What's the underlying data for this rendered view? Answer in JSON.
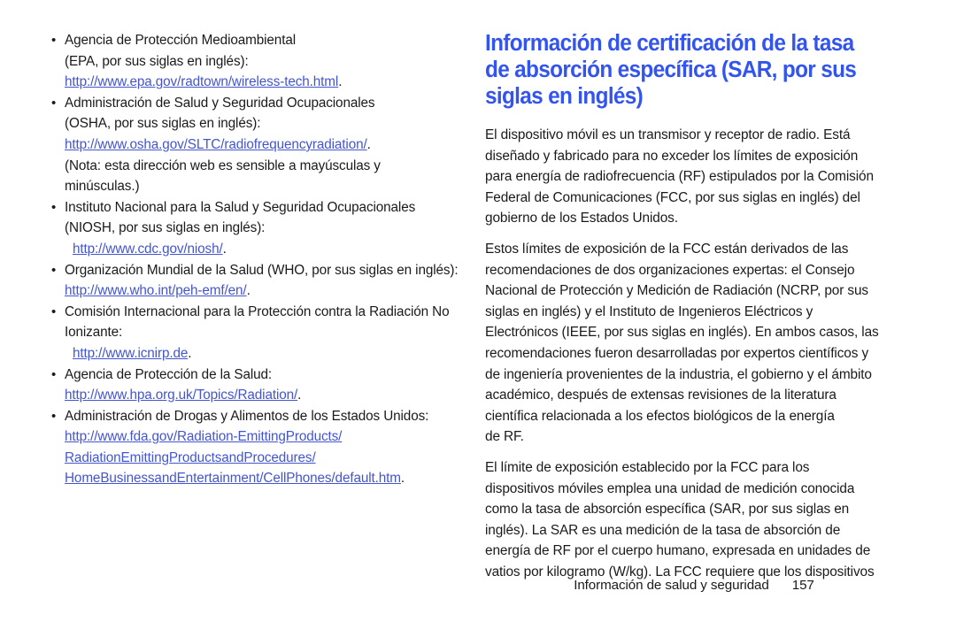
{
  "left_column": {
    "entries": [
      {
        "bullet": "•",
        "lines": [
          {
            "text": "Agencia de Protección Medioambiental",
            "type": "text",
            "indent": false
          },
          {
            "text": "(EPA, por sus siglas en inglés):",
            "type": "text",
            "indent": false
          },
          {
            "text": "http://www.epa.gov/radtown/wireless-tech.html",
            "type": "url",
            "trailing": ".",
            "indent": false
          }
        ]
      },
      {
        "bullet": "•",
        "lines": [
          {
            "text": "Administración de Salud y Seguridad Ocupacionales",
            "type": "text",
            "indent": false
          },
          {
            "text": "(OSHA, por sus siglas en inglés):",
            "type": "text",
            "indent": false
          },
          {
            "text": "http://www.osha.gov/SLTC/radiofrequencyradiation/",
            "type": "url",
            "trailing": ".",
            "indent": false
          },
          {
            "text": "(Nota: esta dirección web es sensible a mayúsculas y",
            "type": "text",
            "indent": false
          },
          {
            "text": "minúsculas.)",
            "type": "text",
            "indent": false
          }
        ]
      },
      {
        "bullet": "•",
        "lines": [
          {
            "text": "Instituto Nacional para la Salud y Seguridad Ocupacionales",
            "type": "text",
            "indent": false
          },
          {
            "text": "(NIOSH, por sus siglas en inglés):",
            "type": "text",
            "indent": false
          },
          {
            "text": "http://www.cdc.gov/niosh/",
            "type": "url",
            "trailing": ".",
            "indent": true
          }
        ]
      },
      {
        "bullet": "•",
        "lines": [
          {
            "text": "Organización Mundial de la Salud (WHO, por sus siglas en inglés):",
            "type": "text",
            "indent": false
          },
          {
            "text": "http://www.who.int/peh-emf/en/",
            "type": "url",
            "trailing": ".",
            "indent": false
          }
        ]
      },
      {
        "bullet": "•",
        "lines": [
          {
            "text": "Comisión Internacional para la Protección contra la Radiación No",
            "type": "text",
            "indent": false
          },
          {
            "text": "Ionizante:",
            "type": "text",
            "indent": false
          },
          {
            "text": "http://www.icnirp.de",
            "type": "url",
            "trailing": ".",
            "indent": true
          }
        ]
      },
      {
        "bullet": "•",
        "lines": [
          {
            "text": "Agencia de Protección de la Salud:",
            "type": "text",
            "indent": false
          },
          {
            "text": "http://www.hpa.org.uk/Topics/Radiation/",
            "type": "url",
            "trailing": ".",
            "indent": false
          }
        ]
      },
      {
        "bullet": "•",
        "lines": [
          {
            "text": "Administración de Drogas y Alimentos de los Estados Unidos:",
            "type": "text",
            "indent": false
          },
          {
            "text": "http://www.fda.gov/Radiation-EmittingProducts/",
            "type": "url",
            "trailing": "",
            "indent": false
          },
          {
            "text": "RadiationEmittingProductsandProcedures/",
            "type": "url",
            "trailing": "",
            "indent": false
          },
          {
            "text": "HomeBusinessandEntertainment/CellPhones/default.htm",
            "type": "url",
            "trailing": ".",
            "indent": false
          }
        ]
      }
    ]
  },
  "right_column": {
    "heading_lines": [
      "Información de certificación de la tasa",
      "de absorción específica (SAR, por sus",
      "siglas en inglés)"
    ],
    "paragraphs": [
      {
        "lines": [
          "El dispositivo móvil es un transmisor y receptor de radio. Está",
          "diseñado y fabricado para no exceder los límites de exposición",
          "para energía de radiofrecuencia (RF) estipulados por la Comisión",
          "Federal de Comunicaciones (FCC, por sus siglas en inglés) del",
          "gobierno de los Estados Unidos."
        ]
      },
      {
        "lines": [
          "Estos límites de exposición de la FCC están derivados de las",
          "recomendaciones de dos organizaciones expertas: el Consejo",
          "Nacional de Protección y Medición de Radiación (NCRP, por sus",
          "siglas en inglés) y el Instituto de Ingenieros Eléctricos y",
          "Electrónicos (IEEE, por sus siglas en inglés). En ambos casos, las",
          "recomendaciones fueron desarrolladas por expertos científicos y",
          "de ingeniería provenientes de la industria, el gobierno y el ámbito",
          "académico, después de extensas revisiones de la literatura",
          "científica relacionada a los efectos biológicos de la energía",
          "de RF."
        ]
      },
      {
        "lines": [
          "El límite de exposición establecido por la FCC para los",
          "dispositivos móviles emplea una unidad de medición conocida",
          "como la tasa de absorción específica (SAR, por sus siglas en",
          "inglés). La SAR es una medición de la tasa de absorción de",
          "energía de RF por el cuerpo humano, expresada en unidades de",
          "vatios por kilogramo (W/kg). La FCC requiere que los dispositivos"
        ]
      }
    ]
  },
  "footer": {
    "label": "Información de salud y seguridad",
    "page_number": "157"
  },
  "colors": {
    "heading_blue": "#3355ee",
    "link_blue": "#4356cf",
    "body_text": "#1a1a1a",
    "background": "#ffffff"
  }
}
